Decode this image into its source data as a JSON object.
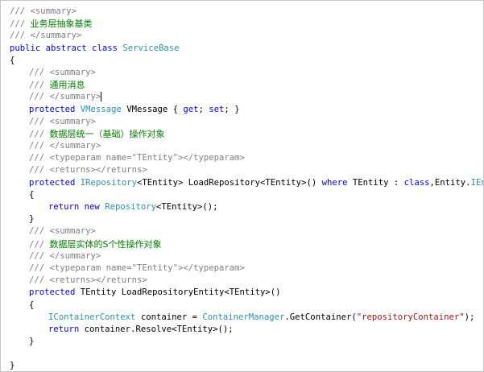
{
  "colors": {
    "doc_slash": "#808080",
    "doc_tag": "#808080",
    "doc_text": "#008000",
    "keyword": "#0000ff",
    "type": "#2b91af",
    "string": "#a31515",
    "plain": "#000000",
    "background": "#ffffff",
    "border": "#c8c8c8"
  },
  "lines": [
    {
      "indent": 0,
      "tokens": [
        {
          "t": "/// ",
          "c": "doc-slash"
        },
        {
          "t": "<summary>",
          "c": "doc-tag"
        }
      ]
    },
    {
      "indent": 0,
      "tokens": [
        {
          "t": "/// ",
          "c": "doc-slash"
        },
        {
          "t": "业务层抽象基类",
          "c": "doc-text"
        }
      ]
    },
    {
      "indent": 0,
      "tokens": [
        {
          "t": "/// ",
          "c": "doc-slash"
        },
        {
          "t": "</summary>",
          "c": "doc-tag"
        }
      ]
    },
    {
      "indent": 0,
      "tokens": [
        {
          "t": "public",
          "c": "kw"
        },
        {
          "t": " ",
          "c": "plain"
        },
        {
          "t": "abstract",
          "c": "kw"
        },
        {
          "t": " ",
          "c": "plain"
        },
        {
          "t": "class",
          "c": "kw"
        },
        {
          "t": " ",
          "c": "plain"
        },
        {
          "t": "ServiceBase",
          "c": "type"
        }
      ]
    },
    {
      "indent": 0,
      "tokens": [
        {
          "t": "{",
          "c": "plain"
        }
      ]
    },
    {
      "indent": 1,
      "tokens": [
        {
          "t": "/// ",
          "c": "doc-slash"
        },
        {
          "t": "<summary>",
          "c": "doc-tag"
        }
      ]
    },
    {
      "indent": 1,
      "tokens": [
        {
          "t": "/// ",
          "c": "doc-slash"
        },
        {
          "t": "通用消息",
          "c": "doc-text"
        }
      ]
    },
    {
      "indent": 1,
      "caret": true,
      "tokens": [
        {
          "t": "/// ",
          "c": "doc-slash"
        },
        {
          "t": "</summary>",
          "c": "doc-tag"
        }
      ]
    },
    {
      "indent": 1,
      "tokens": [
        {
          "t": "protected",
          "c": "kw"
        },
        {
          "t": " ",
          "c": "plain"
        },
        {
          "t": "VMessage",
          "c": "type"
        },
        {
          "t": " VMessage { ",
          "c": "plain"
        },
        {
          "t": "get",
          "c": "kw"
        },
        {
          "t": "; ",
          "c": "plain"
        },
        {
          "t": "set",
          "c": "kw"
        },
        {
          "t": "; }",
          "c": "plain"
        }
      ]
    },
    {
      "indent": 1,
      "tokens": [
        {
          "t": "/// ",
          "c": "doc-slash"
        },
        {
          "t": "<summary>",
          "c": "doc-tag"
        }
      ]
    },
    {
      "indent": 1,
      "tokens": [
        {
          "t": "/// ",
          "c": "doc-slash"
        },
        {
          "t": "数据层统一（基础）操作对象",
          "c": "doc-text"
        }
      ]
    },
    {
      "indent": 1,
      "tokens": [
        {
          "t": "/// ",
          "c": "doc-slash"
        },
        {
          "t": "</summary>",
          "c": "doc-tag"
        }
      ]
    },
    {
      "indent": 1,
      "tokens": [
        {
          "t": "/// ",
          "c": "doc-slash"
        },
        {
          "t": "<typeparam name=\"TEntity\"></typeparam>",
          "c": "doc-tag"
        }
      ]
    },
    {
      "indent": 1,
      "tokens": [
        {
          "t": "/// ",
          "c": "doc-slash"
        },
        {
          "t": "<returns></returns>",
          "c": "doc-tag"
        }
      ]
    },
    {
      "indent": 1,
      "tokens": [
        {
          "t": "protected",
          "c": "kw"
        },
        {
          "t": " ",
          "c": "plain"
        },
        {
          "t": "IRepository",
          "c": "type"
        },
        {
          "t": "<TEntity> LoadRepository<TEntity>() ",
          "c": "plain"
        },
        {
          "t": "where",
          "c": "kw"
        },
        {
          "t": " TEntity : ",
          "c": "plain"
        },
        {
          "t": "class",
          "c": "kw"
        },
        {
          "t": ",Entity.",
          "c": "plain"
        },
        {
          "t": "IEntity",
          "c": "type"
        }
      ]
    },
    {
      "indent": 1,
      "tokens": [
        {
          "t": "{",
          "c": "plain"
        }
      ]
    },
    {
      "indent": 2,
      "tokens": [
        {
          "t": "return",
          "c": "kw"
        },
        {
          "t": " ",
          "c": "plain"
        },
        {
          "t": "new",
          "c": "kw"
        },
        {
          "t": " ",
          "c": "plain"
        },
        {
          "t": "Repository",
          "c": "type"
        },
        {
          "t": "<TEntity>();",
          "c": "plain"
        }
      ]
    },
    {
      "indent": 1,
      "tokens": [
        {
          "t": "}",
          "c": "plain"
        }
      ]
    },
    {
      "indent": 1,
      "tokens": [
        {
          "t": "/// ",
          "c": "doc-slash"
        },
        {
          "t": "<summary>",
          "c": "doc-tag"
        }
      ]
    },
    {
      "indent": 1,
      "tokens": [
        {
          "t": "/// ",
          "c": "doc-slash"
        },
        {
          "t": "数据层实体的S个性操作对象",
          "c": "doc-text"
        }
      ]
    },
    {
      "indent": 1,
      "tokens": [
        {
          "t": "/// ",
          "c": "doc-slash"
        },
        {
          "t": "</summary>",
          "c": "doc-tag"
        }
      ]
    },
    {
      "indent": 1,
      "tokens": [
        {
          "t": "/// ",
          "c": "doc-slash"
        },
        {
          "t": "<typeparam name=\"TEntity\"></typeparam>",
          "c": "doc-tag"
        }
      ]
    },
    {
      "indent": 1,
      "tokens": [
        {
          "t": "/// ",
          "c": "doc-slash"
        },
        {
          "t": "<returns></returns>",
          "c": "doc-tag"
        }
      ]
    },
    {
      "indent": 1,
      "tokens": [
        {
          "t": "protected",
          "c": "kw"
        },
        {
          "t": " TEntity LoadRepositoryEntity<TEntity>()",
          "c": "plain"
        }
      ]
    },
    {
      "indent": 1,
      "tokens": [
        {
          "t": "{",
          "c": "plain"
        }
      ]
    },
    {
      "indent": 2,
      "tokens": [
        {
          "t": "IContainerContext",
          "c": "type"
        },
        {
          "t": " container = ",
          "c": "plain"
        },
        {
          "t": "ContainerManager",
          "c": "type"
        },
        {
          "t": ".GetContainer(",
          "c": "plain"
        },
        {
          "t": "\"repositoryContainer\"",
          "c": "str"
        },
        {
          "t": ");",
          "c": "plain"
        }
      ]
    },
    {
      "indent": 2,
      "tokens": [
        {
          "t": "return",
          "c": "kw"
        },
        {
          "t": " container.Resolve<TEntity>();",
          "c": "plain"
        }
      ]
    },
    {
      "indent": 1,
      "tokens": [
        {
          "t": "}",
          "c": "plain"
        }
      ]
    },
    {
      "indent": 0,
      "tokens": []
    },
    {
      "indent": 0,
      "tokens": [
        {
          "t": "}",
          "c": "plain"
        }
      ]
    }
  ]
}
